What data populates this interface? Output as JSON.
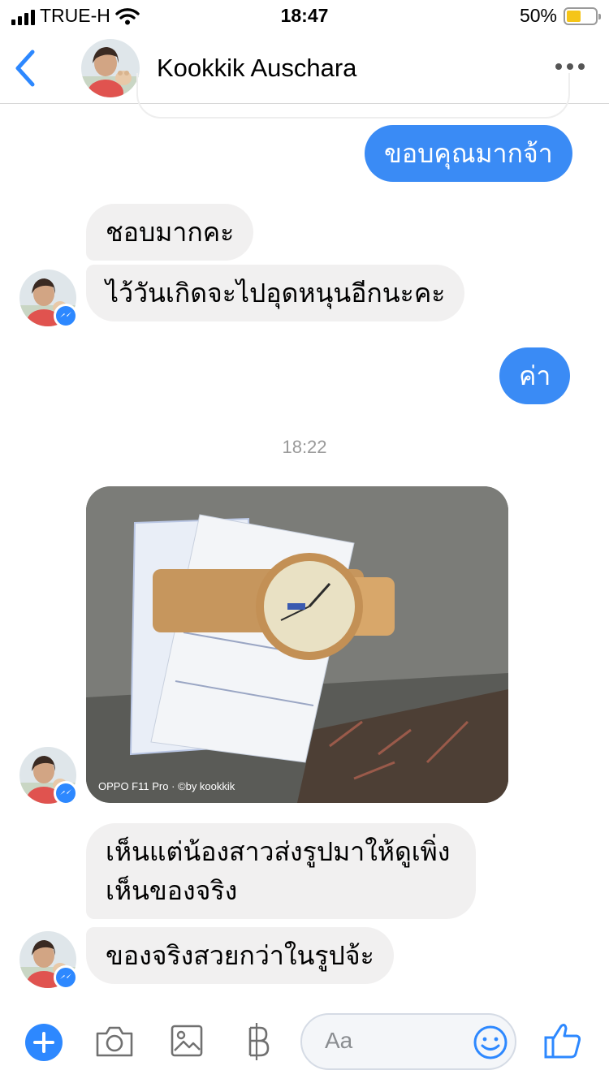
{
  "status_bar": {
    "carrier": "TRUE-H",
    "time": "18:47",
    "battery": "50%",
    "battery_level": 0.5
  },
  "header": {
    "contact_name": "Kookkik Auschara",
    "back_icon": "chevron-left-icon",
    "more_icon": "ellipsis-icon"
  },
  "messages": [
    {
      "direction": "outgoing",
      "text": "ขอบคุณมากจ้า"
    },
    {
      "direction": "incoming",
      "text": "ชอบมากคะ"
    },
    {
      "direction": "incoming",
      "text": "ไว้วันเกิดจะไปอุดหนุนอีกนะคะ"
    },
    {
      "direction": "outgoing",
      "text": "ค่า"
    },
    {
      "direction": "incoming",
      "type": "photo",
      "watermark": "OPPO F11 Pro · ©by kookkik"
    },
    {
      "direction": "incoming",
      "lines": [
        "เห็นแต่น้องสาวส่งรูปมาให้ดูเพิ่ง",
        "เห็นของจริง"
      ]
    },
    {
      "direction": "incoming",
      "text": "ของจริงสวยกว่าในรูปจ้ะ"
    }
  ],
  "timestamp": "18:22",
  "composer": {
    "placeholder": "Aa",
    "icons": [
      "plus-icon",
      "camera-icon",
      "gallery-icon",
      "baht-icon",
      "emoji-icon",
      "thumbs-up-icon"
    ]
  },
  "colors": {
    "accent": "#2d88ff",
    "outgoing_bubble": "#3a8bf5",
    "incoming_bubble": "#f1f0f0"
  }
}
